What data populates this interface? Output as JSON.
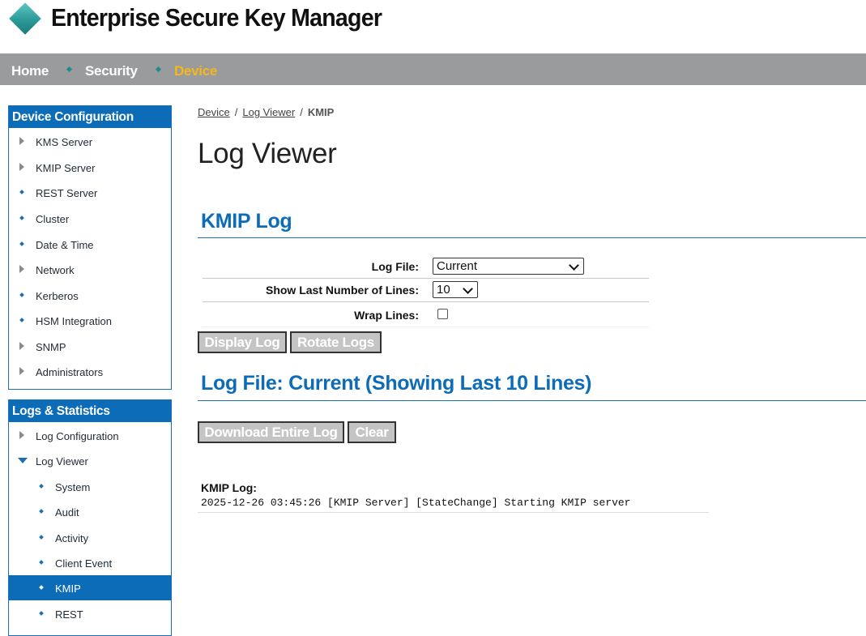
{
  "app": {
    "title": "Enterprise Secure Key Manager"
  },
  "nav": {
    "items": [
      {
        "label": "Home",
        "active": false
      },
      {
        "label": "Security",
        "active": false
      },
      {
        "label": "Device",
        "active": true
      }
    ]
  },
  "sidebar": {
    "device_config": {
      "title": "Device Configuration",
      "items": [
        {
          "label": "KMS Server",
          "icon": "expand-arrow-icon"
        },
        {
          "label": "KMIP Server",
          "icon": "expand-arrow-icon"
        },
        {
          "label": "REST Server",
          "icon": "bullet-icon"
        },
        {
          "label": "Cluster",
          "icon": "bullet-icon"
        },
        {
          "label": "Date & Time",
          "icon": "bullet-icon"
        },
        {
          "label": "Network",
          "icon": "expand-arrow-icon"
        },
        {
          "label": "Kerberos",
          "icon": "bullet-icon"
        },
        {
          "label": "HSM Integration",
          "icon": "bullet-icon"
        },
        {
          "label": "SNMP",
          "icon": "expand-arrow-icon"
        },
        {
          "label": "Administrators",
          "icon": "expand-arrow-icon"
        }
      ]
    },
    "logs_stats": {
      "title": "Logs & Statistics",
      "items": [
        {
          "label": "Log Configuration",
          "icon": "expand-arrow-icon"
        },
        {
          "label": "Log Viewer",
          "icon": "collapse-arrow-icon"
        },
        {
          "label": "System",
          "icon": "bullet-icon"
        },
        {
          "label": "Audit",
          "icon": "bullet-icon"
        },
        {
          "label": "Activity",
          "icon": "bullet-icon"
        },
        {
          "label": "Client Event",
          "icon": "bullet-icon"
        },
        {
          "label": "KMIP",
          "icon": "bullet-icon",
          "active": true
        },
        {
          "label": "REST",
          "icon": "bullet-icon"
        }
      ]
    }
  },
  "breadcrumb": {
    "items": [
      "Device",
      "Log Viewer"
    ],
    "separator": "/",
    "current": "KMIP"
  },
  "main": {
    "page_title": "Log Viewer",
    "section_title": "KMIP Log",
    "form": {
      "log_file_label": "Log File:",
      "log_file_value": "Current",
      "lines_label": "Show Last Number of Lines:",
      "lines_value": "10",
      "wrap_label": "Wrap Lines:",
      "wrap_checked": false
    },
    "buttons": {
      "display": "Display Log",
      "rotate": "Rotate Logs"
    },
    "log_section_title": "Log File: Current (Showing Last 10 Lines)",
    "log_buttons": {
      "download": "Download Entire Log",
      "clear": "Clear"
    },
    "log": {
      "title": "KMIP Log:",
      "lines": [
        "2025-12-26 03:45:26 [KMIP Server] [StateChange] Starting KMIP server"
      ]
    }
  },
  "colors": {
    "accent": "#0d6cb8",
    "nav_bg": "#999b9c",
    "nav_active": "#f5b81c",
    "brand": "#2a9a98"
  }
}
